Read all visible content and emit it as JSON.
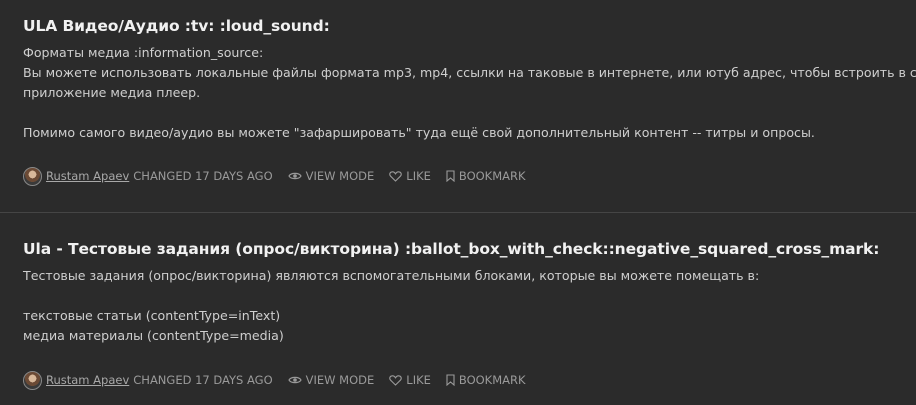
{
  "posts": [
    {
      "title": "ULA Видео/Аудио :tv: :loud_sound:",
      "lines": [
        "Форматы медиа :information_source:",
        "Вы можете использовать локальные файлы формата mp3, mp4, ссылки на таковые в интернете, или ютуб адрес, чтобы встроить в своё",
        "приложение медиа плеер.",
        "",
        "Помимо самого видео/аудио вы можете \"зафаршировать\" туда ещё свой дополнительный контент -- титры и опросы."
      ],
      "author": "Rustam Apaev",
      "changed": "changed 17 days ago",
      "view_mode": "View mode",
      "like": "Like",
      "bookmark": "Bookmark"
    },
    {
      "title": "Ula - Тестовые задания (опрос/викторина) :ballot_box_with_check::negative_squared_cross_mark:",
      "lines": [
        "Тестовые задания (опрос/викторина) являются вспомогательными блоками, которые вы можете помещать в:",
        "",
        "текстовые статьи (contentType=inText)",
        "медиа материалы (contentType=media)"
      ],
      "author": "Rustam Apaev",
      "changed": "changed 17 days ago",
      "view_mode": "View mode",
      "like": "Like",
      "bookmark": "Bookmark"
    }
  ],
  "icons": {
    "avatar": "avatar",
    "view_mode": "eye-icon",
    "like": "heart-icon",
    "bookmark": "bookmark-icon"
  },
  "colors": {
    "background": "#2b2b2b",
    "title": "#f1f1f1",
    "body_text": "#cfcfcf",
    "meta_text": "#9a9a9a",
    "divider": "#454545"
  }
}
